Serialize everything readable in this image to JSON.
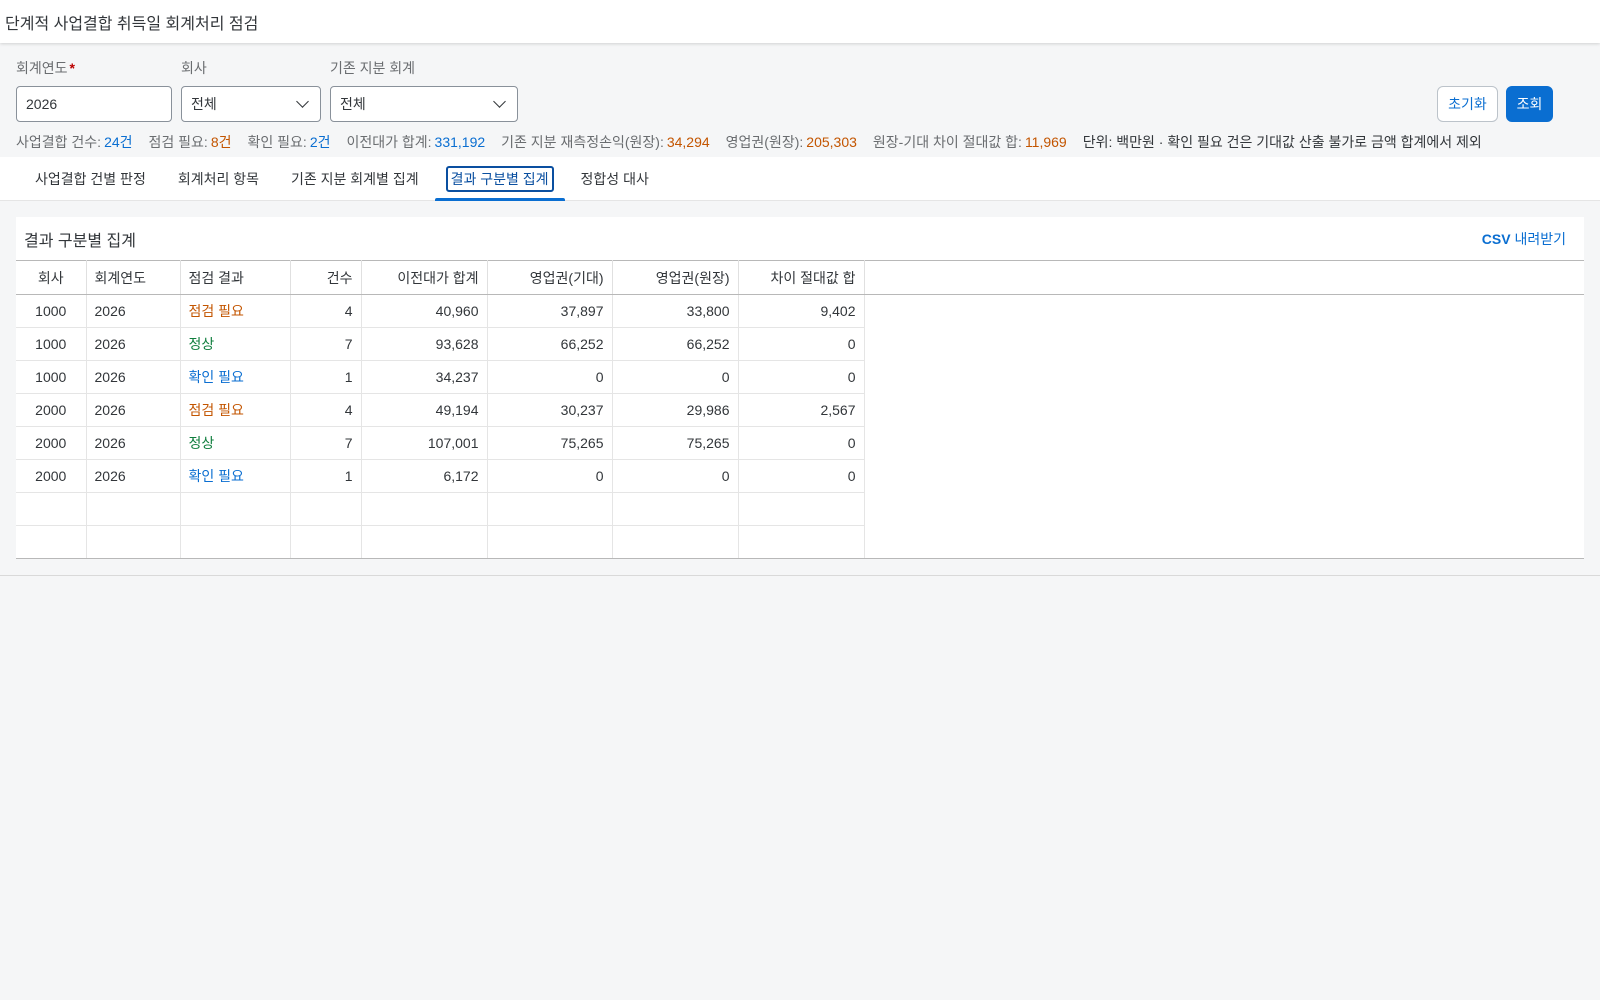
{
  "app": {
    "title": "단계적 사업결합 취득일 회계처리 점검"
  },
  "filters": {
    "year_label": "회계연도",
    "year_required": "*",
    "year_value": "2026",
    "company_label": "회사",
    "company_value": "전체",
    "method_label": "기존 지분 회계",
    "method_value": "전체",
    "reset_label": "초기화",
    "search_label": "조회"
  },
  "kpis": [
    {
      "label": "사업결합 건수:",
      "value": "24건",
      "color": "blue"
    },
    {
      "label": "점검 필요:",
      "value": "8건",
      "color": "orange"
    },
    {
      "label": "확인 필요:",
      "value": "2건",
      "color": "blue"
    },
    {
      "label": "이전대가 합계:",
      "value": "331,192",
      "color": "blue"
    },
    {
      "label": "기존 지분 재측정손익(원장):",
      "value": "34,294",
      "color": "orange"
    },
    {
      "label": "영업권(원장):",
      "value": "205,303",
      "color": "orange"
    },
    {
      "label": "원장-기대 차이 절대값 합:",
      "value": "11,969",
      "color": "orange"
    }
  ],
  "kpi_note": "단위: 백만원 · 확인 필요 건은 기대값 산출 불가로 금액 합계에서 제외",
  "tabs": [
    {
      "label": "사업결합 건별 판정",
      "active": false
    },
    {
      "label": "회계처리 항목",
      "active": false
    },
    {
      "label": "기존 지분 회계별 집계",
      "active": false
    },
    {
      "label": "결과 구분별 집계",
      "active": true
    },
    {
      "label": "정합성 대사",
      "active": false
    }
  ],
  "panel": {
    "title": "결과 구분별 집계",
    "csv_prefix": "CSV",
    "csv_label": "내려받기"
  },
  "table": {
    "columns": [
      "회사",
      "회계연도",
      "점검 결과",
      "건수",
      "이전대가 합계",
      "영업권(기대)",
      "영업권(원장)",
      "차이 절대값 합"
    ],
    "rows": [
      {
        "company": "1000",
        "year": "2026",
        "result": "점검 필요",
        "status": "orange",
        "count": "4",
        "consideration": "40,960",
        "gw_expected": "37,897",
        "gw_ledger": "33,800",
        "diff": "9,402"
      },
      {
        "company": "1000",
        "year": "2026",
        "result": "정상",
        "status": "green",
        "count": "7",
        "consideration": "93,628",
        "gw_expected": "66,252",
        "gw_ledger": "66,252",
        "diff": "0"
      },
      {
        "company": "1000",
        "year": "2026",
        "result": "확인 필요",
        "status": "blue",
        "count": "1",
        "consideration": "34,237",
        "gw_expected": "0",
        "gw_ledger": "0",
        "diff": "0"
      },
      {
        "company": "2000",
        "year": "2026",
        "result": "점검 필요",
        "status": "orange",
        "count": "4",
        "consideration": "49,194",
        "gw_expected": "30,237",
        "gw_ledger": "29,986",
        "diff": "2,567"
      },
      {
        "company": "2000",
        "year": "2026",
        "result": "정상",
        "status": "green",
        "count": "7",
        "consideration": "107,001",
        "gw_expected": "75,265",
        "gw_ledger": "75,265",
        "diff": "0"
      },
      {
        "company": "2000",
        "year": "2026",
        "result": "확인 필요",
        "status": "blue",
        "count": "1",
        "consideration": "6,172",
        "gw_expected": "0",
        "gw_ledger": "0",
        "diff": "0"
      }
    ],
    "empty_rows": 2
  },
  "colors": {
    "accent": "#0a6ed1",
    "orange": "#c35500",
    "green": "#107e3e"
  }
}
